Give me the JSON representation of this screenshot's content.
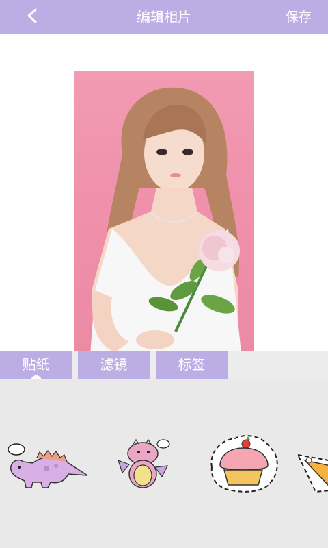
{
  "header": {
    "title": "编辑相片",
    "save_label": "保存",
    "back_icon": "chevron-left-icon"
  },
  "tabs": [
    {
      "label": "贴纸",
      "selected": true
    },
    {
      "label": "滤镜",
      "selected": false
    },
    {
      "label": "标签",
      "selected": false
    }
  ],
  "stickers": [
    {
      "name": "dinosaur-sticker"
    },
    {
      "name": "dragon-sticker"
    },
    {
      "name": "cupcake-sticker"
    },
    {
      "name": "cake-slice-sticker"
    }
  ],
  "colors": {
    "accent": "#bcaee4",
    "panel": "#e9e9e9",
    "photo_bg": "#f29ab3"
  }
}
